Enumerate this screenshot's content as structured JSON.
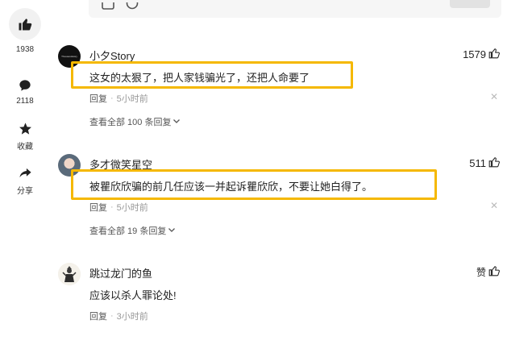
{
  "rail": {
    "like_count": "1938",
    "comment_count": "2118",
    "favorite_label": "收藏",
    "share_label": "分享"
  },
  "comments": [
    {
      "username": "小夕Story",
      "avatar_text": "Thousandstory",
      "likes": "1579",
      "text": "这女的太狠了，把人家钱骗光了，还把人命要了",
      "reply_label": "回复",
      "time": "5小时前",
      "view_all": "查看全部 100 条回复",
      "highlighted": true
    },
    {
      "username": "多才微笑星空",
      "likes": "511",
      "text": "被瞿欣欣骗的前几任应该一并起诉瞿欣欣，不要让她白得了。",
      "reply_label": "回复",
      "time": "5小时前",
      "view_all": "查看全部 19 条回复",
      "highlighted": true
    },
    {
      "username": "跳过龙门的鱼",
      "likes": "赞",
      "text": "应该以杀人罪论处!",
      "reply_label": "回复",
      "time": "3小时前"
    }
  ],
  "colors": {
    "highlight": "#f5b800",
    "meta_text": "#999999",
    "rail_circle": "#f1f1f1"
  }
}
